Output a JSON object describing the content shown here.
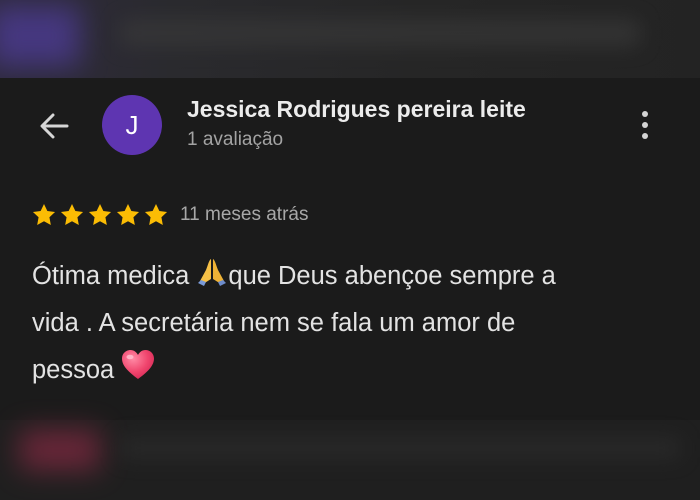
{
  "review": {
    "reviewer_name": "Jessica Rodrigues pereira leite",
    "avatar_initial": "J",
    "reviews_count": "1 avaliação",
    "rating": 5,
    "rating_max": 5,
    "time_ago": "11 meses atrás",
    "text_line1_a": "Ótima medica ",
    "text_line1_b": "que Deus abençoe sempre a",
    "text_line2": "vida . A secretária nem se fala um amor de",
    "text_line3": "pessoa "
  },
  "icons": {
    "back": "arrow-left-icon",
    "more": "more-vert-icon",
    "star": "star-icon",
    "pray": "folded-hands-emoji",
    "heart": "heart-emoji"
  },
  "colors": {
    "background": "#1b1b1b",
    "avatar": "#5e35b1",
    "star": "#fbbc04",
    "primary_text": "#ececec",
    "secondary_text": "#a3a3a3"
  }
}
